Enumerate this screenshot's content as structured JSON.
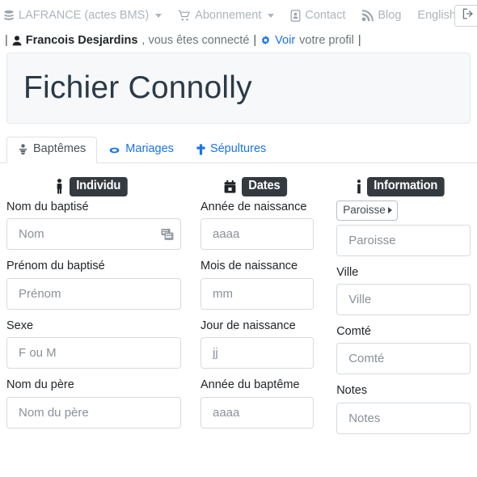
{
  "topnav": {
    "items": [
      {
        "label": "LAFRANCE (actes BMS)",
        "icon": "database-icon",
        "caret": true
      },
      {
        "label": "Abonnement",
        "icon": "cart-icon",
        "caret": true
      },
      {
        "label": "Contact",
        "icon": "id-card-icon",
        "caret": false
      },
      {
        "label": "Blog",
        "icon": "rss-icon",
        "caret": false
      },
      {
        "label": "English",
        "icon": "",
        "caret": false
      }
    ],
    "logout_icon": "sign-out-icon"
  },
  "userbar": {
    "pipe_left": "|",
    "user_name": "Francois Desjardins",
    "connected_text": ", vous êtes connecté",
    "pipe_mid": "|",
    "profile_link": "Voir",
    "profile_tail": "votre profil",
    "pipe_right": "|",
    "person_icon": "user-icon",
    "gear_icon": "gear-icon"
  },
  "page": {
    "title": "Fichier Connolly"
  },
  "tabs": [
    {
      "label": "Baptêmes",
      "icon": "baby-icon",
      "active": true
    },
    {
      "label": "Mariages",
      "icon": "ring-icon",
      "active": false
    },
    {
      "label": "Sépultures",
      "icon": "cross-icon",
      "active": false
    }
  ],
  "columns": [
    {
      "heading": {
        "icon": "person-icon",
        "badge": "Individu"
      },
      "fields": [
        {
          "label": "Nom du baptisé",
          "placeholder": "Nom",
          "value": "",
          "trailing_icon": "keyboard-icon"
        },
        {
          "label": "Prénom du baptisé",
          "placeholder": "Prénom",
          "value": ""
        },
        {
          "label": "Sexe",
          "placeholder": "F ou M",
          "value": ""
        },
        {
          "label": "Nom du père",
          "placeholder": "Nom du père",
          "value": ""
        }
      ]
    },
    {
      "heading": {
        "icon": "calendar-icon",
        "badge": "Dates"
      },
      "fields": [
        {
          "label": "Année de naissance",
          "placeholder": "aaaa",
          "value": ""
        },
        {
          "label": "Mois de naissance",
          "placeholder": "mm",
          "value": ""
        },
        {
          "label": "Jour de naissance",
          "placeholder": "jj",
          "value": ""
        },
        {
          "label": "Année du baptême",
          "placeholder": "aaaa",
          "value": ""
        }
      ]
    },
    {
      "heading": {
        "icon": "info-icon",
        "badge": "Information"
      },
      "button": {
        "label": "Paroisse",
        "caret": "▸"
      },
      "fields": [
        {
          "label": "",
          "placeholder": "Paroisse",
          "value": ""
        },
        {
          "label": "Ville",
          "placeholder": "Ville",
          "value": ""
        },
        {
          "label": "Comté",
          "placeholder": "Comté",
          "value": ""
        },
        {
          "label": "Notes",
          "placeholder": "Notes",
          "value": ""
        }
      ]
    }
  ],
  "colors": {
    "link": "#1a73e8",
    "badge_bg": "#343a40",
    "muted": "#adb5bd",
    "jumbotron_bg": "#f6f8fa"
  }
}
